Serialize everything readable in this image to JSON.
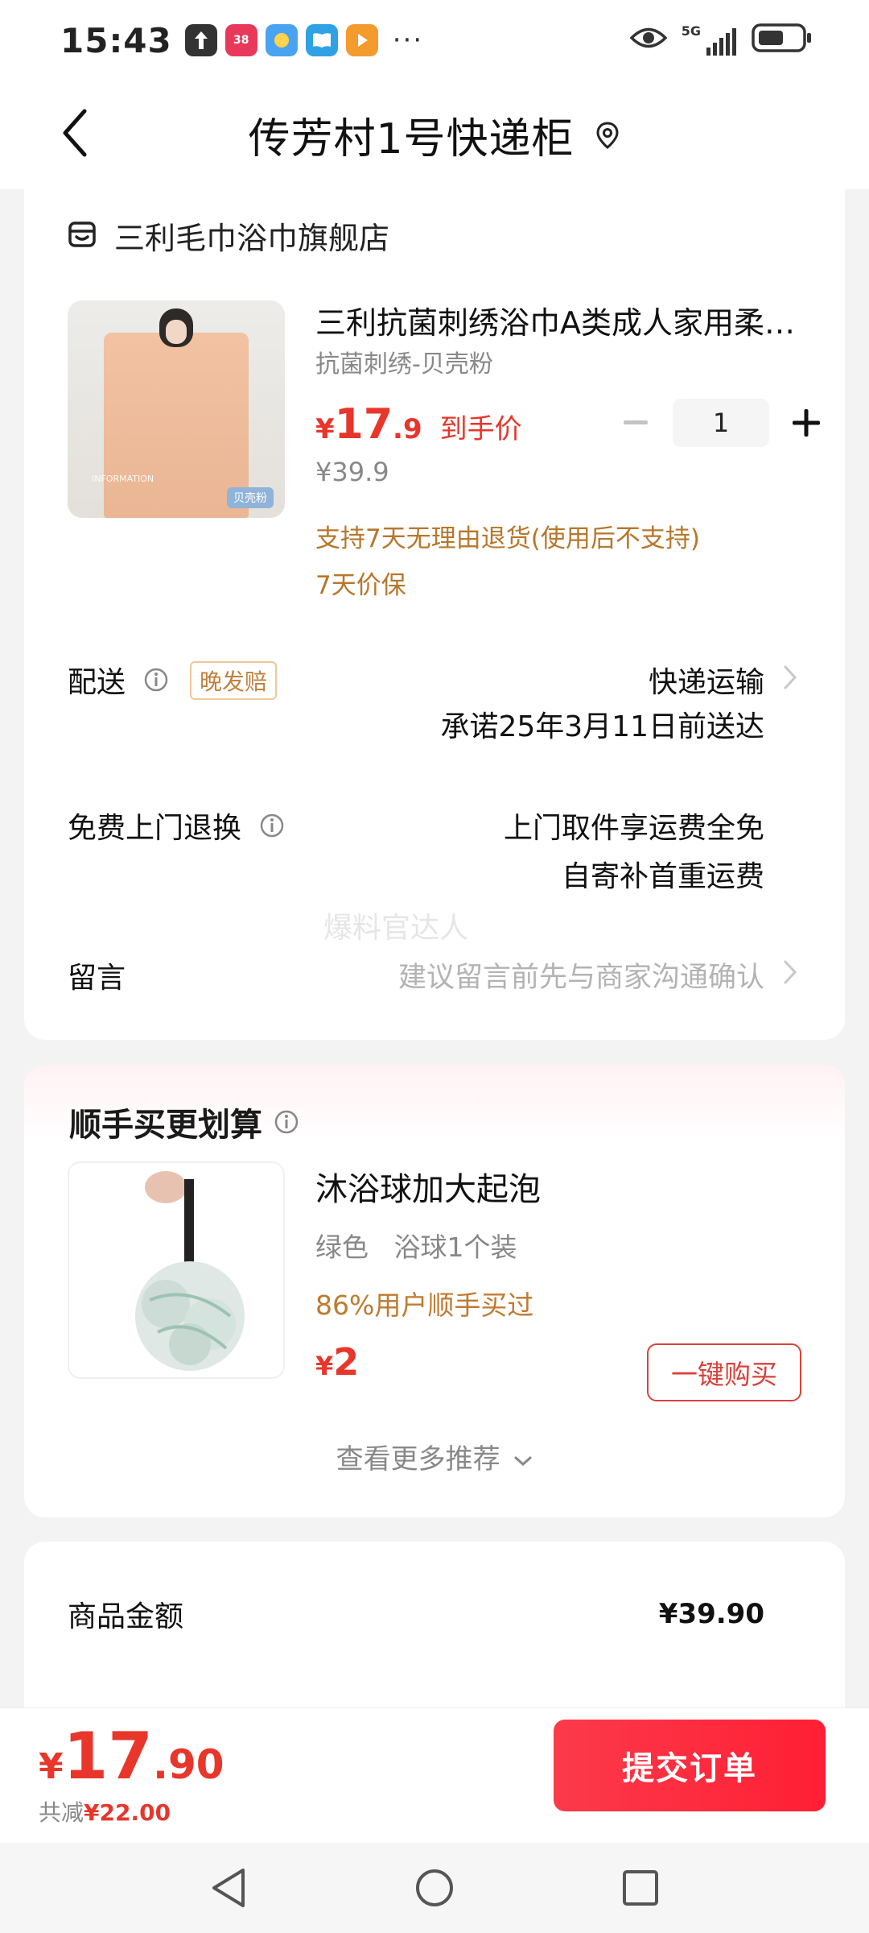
{
  "status_bar": {
    "time": "15:43",
    "app_icons": [
      "upload-notification-icon",
      "38-festival-app-icon",
      "weather-app-icon",
      "book-app-icon",
      "video-app-icon"
    ],
    "more": "···",
    "network": "5G",
    "icons": [
      "eye-icon",
      "signal-icon",
      "battery-icon"
    ]
  },
  "header": {
    "title": "传芳村1号快递柜",
    "back_icon": "chevron-left-icon",
    "location_icon": "location-pin-icon"
  },
  "order": {
    "shop_icon": "store-icon",
    "shop_name": "三利毛巾浴巾旗舰店",
    "product": {
      "title": "三利抗菌刺绣浴巾A类成人家用柔…",
      "variant": "抗菌刺绣-贝壳粉",
      "price_currency": "¥",
      "price_int": "17",
      "price_dec": ".9",
      "price_label": "到手价",
      "original_price": "¥39.9",
      "quantity": "1",
      "image_tag": "贝壳粉",
      "image_info": "INFORMATION",
      "perks": [
        "支持7天无理由退货(使用后不支持)",
        "7天价保"
      ]
    },
    "delivery": {
      "label": "配送",
      "badge": "晚发赔",
      "method": "快递运输",
      "promise": "承诺25年3月11日前送达"
    },
    "returns": {
      "label": "免费上门退换",
      "line1": "上门取件享运费全免",
      "line2": "自寄补首重运费"
    },
    "watermark": "爆料官达人",
    "message": {
      "label": "留言",
      "placeholder": "建议留言前先与商家沟通确认"
    }
  },
  "recommend": {
    "title": "顺手买更划算",
    "item": {
      "name": "沐浴球加大起泡",
      "variant": "绿色   浴球1个装",
      "stat": "86%用户顺手买过",
      "price_currency": "¥",
      "price": "2",
      "buy_label": "一键购买"
    },
    "more_label": "查看更多推荐"
  },
  "summary": {
    "label": "商品金额",
    "value": "¥39.90"
  },
  "bottom": {
    "currency": "¥",
    "total_int": "17",
    "total_dec": ".90",
    "discount_prefix": "共减",
    "discount_amount": "¥22.00",
    "submit_label": "提交订单"
  },
  "colors": {
    "accent_red": "#e8362b",
    "perk_orange": "#b7772b",
    "submit_gradient": "#ff1f34"
  }
}
